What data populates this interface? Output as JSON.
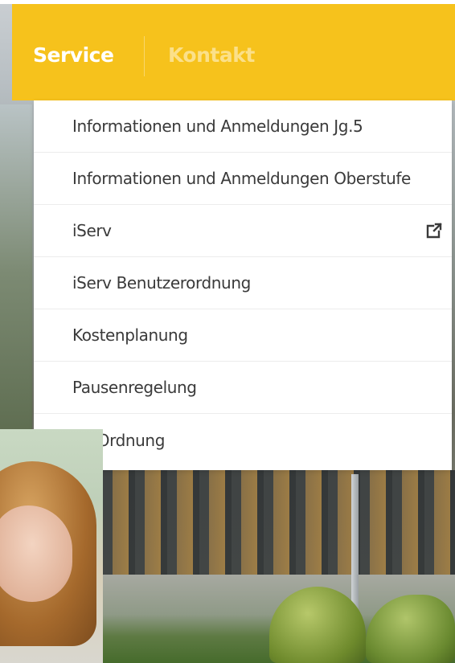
{
  "nav": {
    "items": [
      {
        "label": "Service"
      },
      {
        "label": "Kontakt"
      }
    ]
  },
  "dropdown": {
    "items": [
      {
        "label": "Informationen und Anmeldungen Jg.5",
        "external": false
      },
      {
        "label": "Informationen und Anmeldungen Oberstufe",
        "external": false
      },
      {
        "label": "iServ",
        "external": true,
        "icon": "external-link-icon"
      },
      {
        "label": "iServ Benutzerordnung",
        "external": false
      },
      {
        "label": "Kostenplanung",
        "external": false
      },
      {
        "label": "Pausenregelung",
        "external": false
      },
      {
        "label": "dy-Ordnung",
        "external": false
      }
    ]
  },
  "colors": {
    "nav_bg": "#f6c21c",
    "nav_active_text": "#ffffff",
    "nav_inactive_text": "#fbe08a",
    "menu_text": "#3a3a3a"
  }
}
